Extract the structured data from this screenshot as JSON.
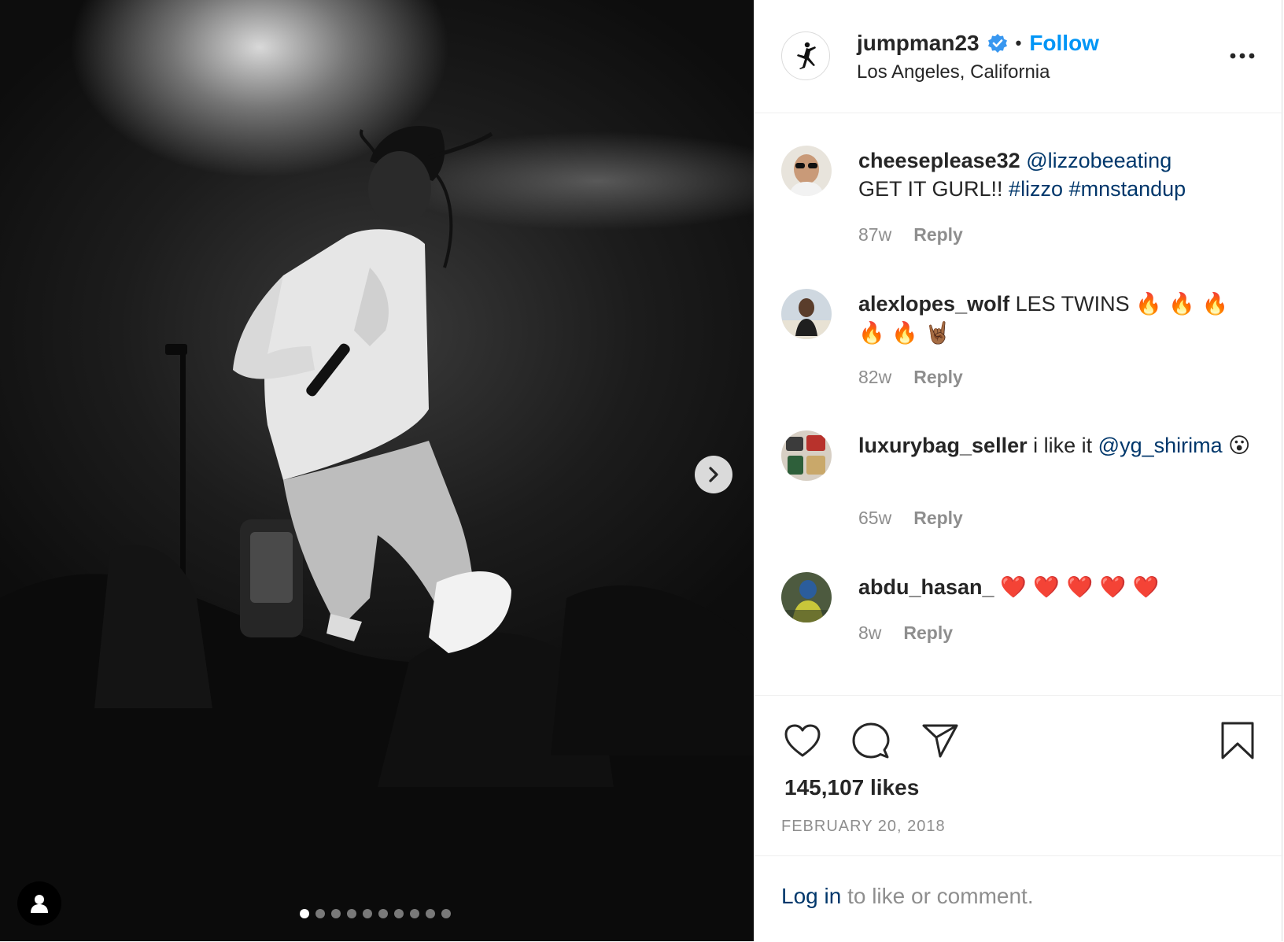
{
  "post": {
    "author": "jumpman23",
    "follow_label": "Follow",
    "separator": "•",
    "location": "Los Angeles, California",
    "verified_icon": "verified-badge-icon",
    "avatar_icon": "jumpman-logo-icon"
  },
  "carousel": {
    "slide_count": 10,
    "active_slide": 1
  },
  "comments": [
    {
      "user": "cheeseplease32",
      "segments": [
        {
          "text": "@lizzobeeating",
          "type": "mention"
        },
        {
          "text": " GET IT GURL!! ",
          "type": "text"
        },
        {
          "text": "#lizzo",
          "type": "mention"
        },
        {
          "text": " ",
          "type": "text"
        },
        {
          "text": "#mnstandup",
          "type": "mention"
        }
      ],
      "age": "87w",
      "reply": "Reply"
    },
    {
      "user": "alexlopes_wolf",
      "segments": [
        {
          "text": "LES TWINS ",
          "type": "text"
        },
        {
          "text": "🔥 🔥 🔥 🔥 🔥 🤘🏾",
          "type": "emoji"
        }
      ],
      "age": "82w",
      "reply": "Reply"
    },
    {
      "user": "luxurybag_seller",
      "segments": [
        {
          "text": "i like it ",
          "type": "text"
        },
        {
          "text": "@yg_shirima",
          "type": "mention"
        },
        {
          "text": " ",
          "type": "text"
        },
        {
          "text": "😮",
          "type": "emoji"
        }
      ],
      "age": "65w",
      "reply": "Reply"
    },
    {
      "user": "abdu_hasan_",
      "segments": [
        {
          "text": "❤️ ❤️ ❤️ ❤️ ❤️",
          "type": "emoji"
        }
      ],
      "age": "8w",
      "reply": "Reply"
    }
  ],
  "actions": {
    "likes": "145,107 likes",
    "date": "FEBRUARY 20, 2018"
  },
  "footer": {
    "login_link": "Log in",
    "login_rest": " to like or comment."
  },
  "colors": {
    "link_blue": "#0095f6",
    "mention_blue": "#00376b",
    "verified_blue": "#3897f0",
    "muted_gray": "#8e8e8e"
  }
}
